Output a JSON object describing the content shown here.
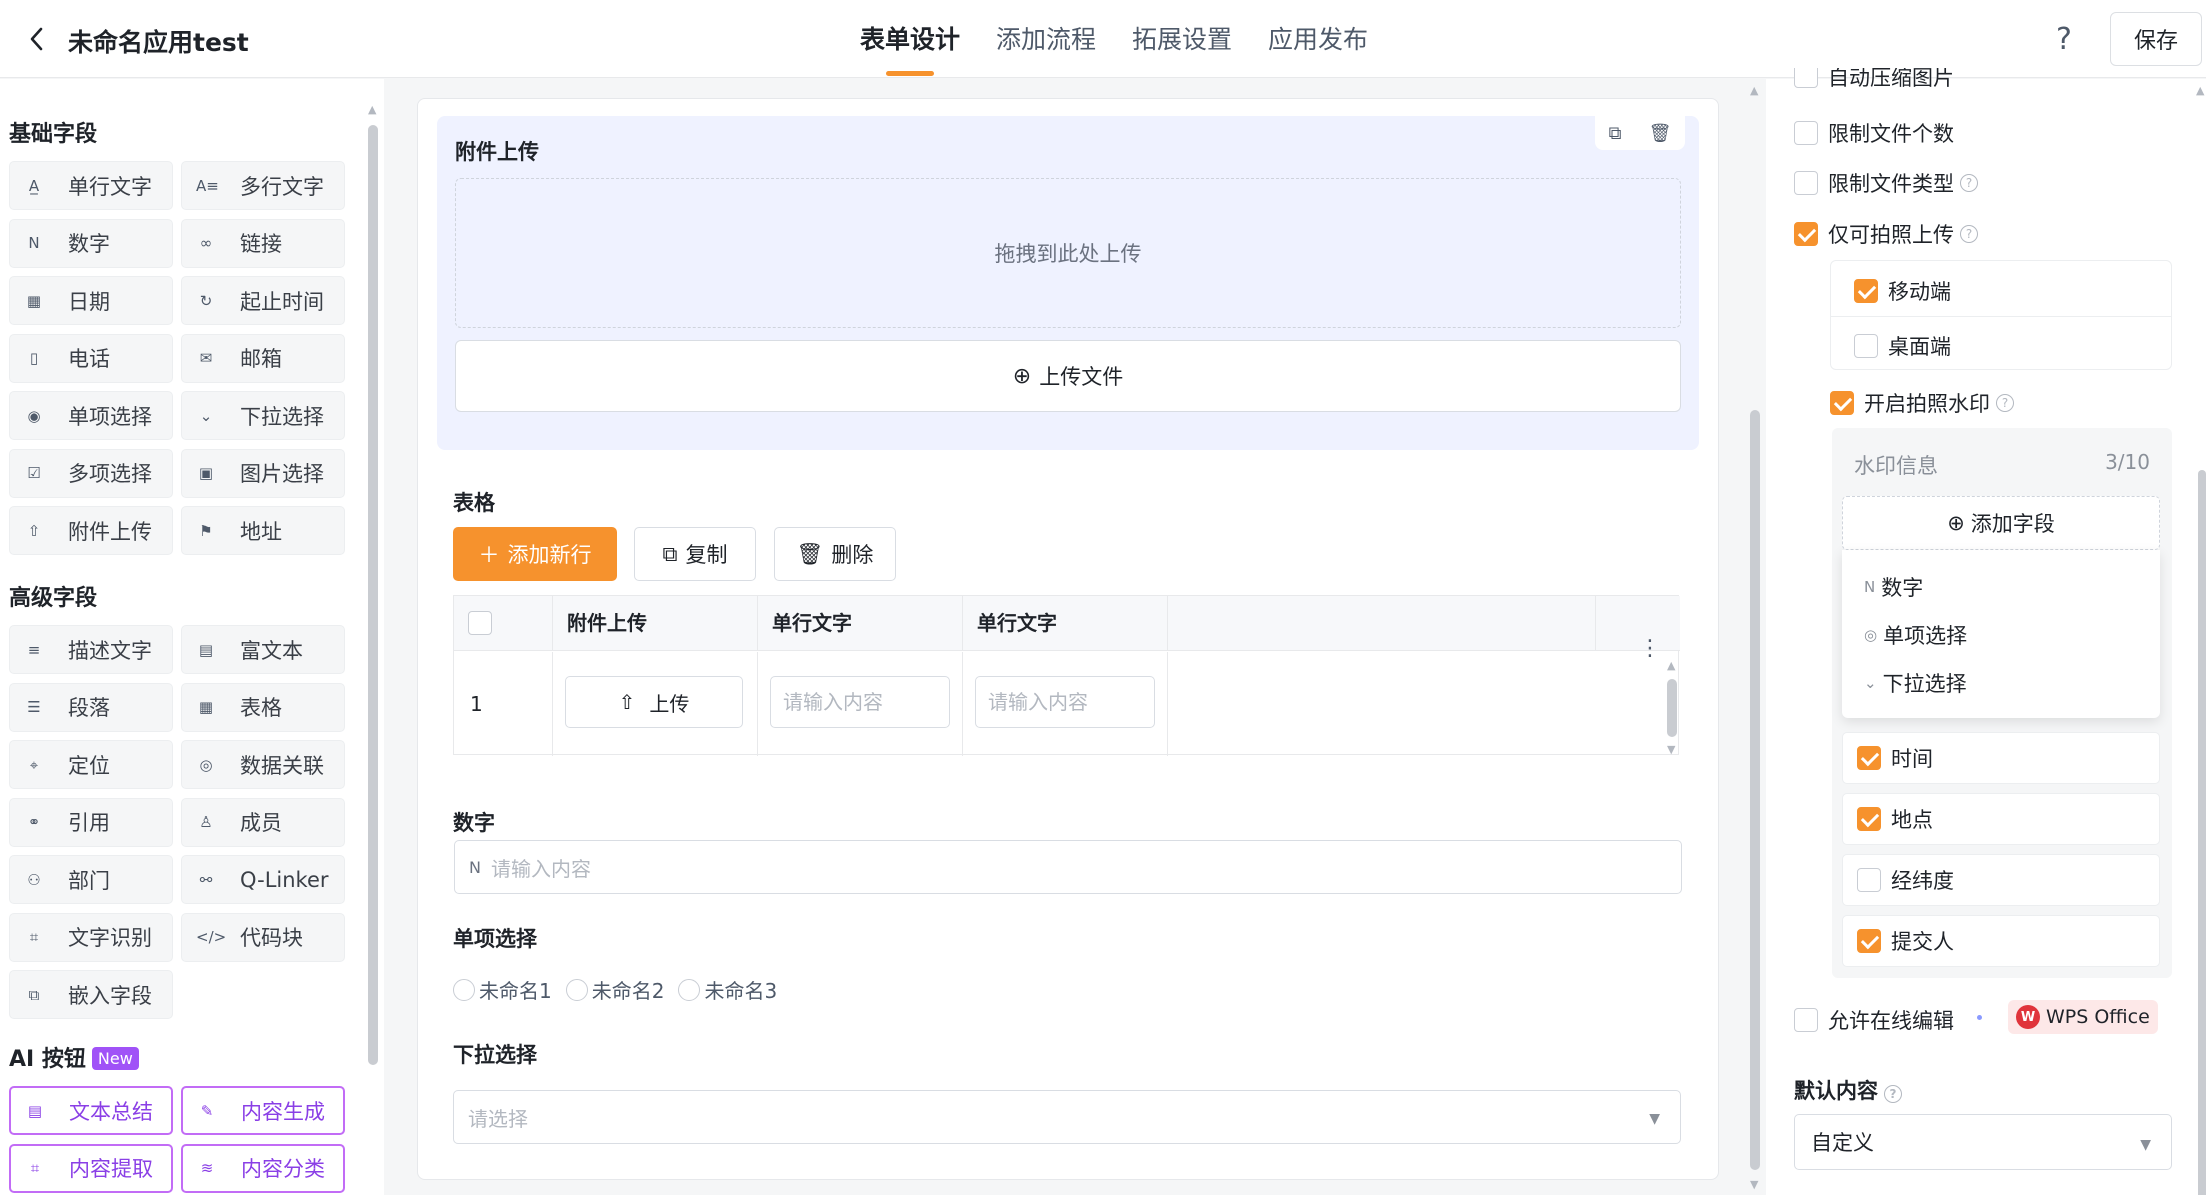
{
  "header": {
    "title": "未命名应用test",
    "tabs": [
      "表单设计",
      "添加流程",
      "拓展设置",
      "应用发布"
    ],
    "active_tab": "表单设计",
    "help": "?",
    "save_label": "保存"
  },
  "left": {
    "basic_title": "基础字段",
    "basic_fields": [
      {
        "label": "单行文字",
        "icon": "A̲"
      },
      {
        "label": "多行文字",
        "icon": "A≡"
      },
      {
        "label": "数字",
        "icon": "N"
      },
      {
        "label": "链接",
        "icon": "∞"
      },
      {
        "label": "日期",
        "icon": "▦"
      },
      {
        "label": "起止时间",
        "icon": "↻"
      },
      {
        "label": "电话",
        "icon": "▯"
      },
      {
        "label": "邮箱",
        "icon": "✉"
      },
      {
        "label": "单项选择",
        "icon": "◉"
      },
      {
        "label": "下拉选择",
        "icon": "⌄"
      },
      {
        "label": "多项选择",
        "icon": "☑"
      },
      {
        "label": "图片选择",
        "icon": "▣"
      },
      {
        "label": "附件上传",
        "icon": "⇧"
      },
      {
        "label": "地址",
        "icon": "⚑"
      }
    ],
    "advanced_title": "高级字段",
    "advanced_fields": [
      {
        "label": "描述文字",
        "icon": "≡"
      },
      {
        "label": "富文本",
        "icon": "▤"
      },
      {
        "label": "段落",
        "icon": "☰"
      },
      {
        "label": "表格",
        "icon": "▦"
      },
      {
        "label": "定位",
        "icon": "⌖"
      },
      {
        "label": "数据关联",
        "icon": "◎"
      },
      {
        "label": "引用",
        "icon": "⚭"
      },
      {
        "label": "成员",
        "icon": "♙"
      },
      {
        "label": "部门",
        "icon": "⚇"
      },
      {
        "label": "Q-Linker",
        "icon": "⚯"
      },
      {
        "label": "文字识别",
        "icon": "⌗"
      },
      {
        "label": "代码块",
        "icon": "</>"
      },
      {
        "label": "嵌入字段",
        "icon": "⧉"
      }
    ],
    "ai_title": "AI 按钮",
    "ai_badge": "New",
    "ai_fields": [
      {
        "label": "文本总结",
        "icon": "▤"
      },
      {
        "label": "内容生成",
        "icon": "✎"
      },
      {
        "label": "内容提取",
        "icon": "⌗"
      },
      {
        "label": "内容分类",
        "icon": "≋"
      }
    ]
  },
  "canvas": {
    "attachment": {
      "title": "附件上传",
      "drop_text": "拖拽到此处上传",
      "upload_btn": "上传文件",
      "tool_copy": "⧉",
      "tool_delete": "🗑"
    },
    "table": {
      "title": "表格",
      "add_row": "添加新行",
      "copy": "复制",
      "delete": "删除",
      "columns": [
        "附件上传",
        "单行文字",
        "单行文字"
      ],
      "row_number": "1",
      "upload_label": "上传",
      "placeholder": "请输入内容"
    },
    "number": {
      "title": "数字",
      "placeholder": "请输入内容"
    },
    "radio": {
      "title": "单项选择",
      "options": [
        "未命名1",
        "未命名2",
        "未命名3"
      ]
    },
    "select": {
      "title": "下拉选择",
      "placeholder": "请选择"
    }
  },
  "right": {
    "top_cut_label": "自动压缩图片",
    "limit_count": "限制文件个数",
    "limit_type": "限制文件类型",
    "photo_only": "仅可拍照上传",
    "mobile": "移动端",
    "desktop": "桌面端",
    "watermark": "开启拍照水印",
    "wm_info_title": "水印信息",
    "wm_count": "3/10",
    "wm_add": "添加字段",
    "dropdown_options": [
      {
        "label": "数字",
        "icon": "N"
      },
      {
        "label": "单项选择",
        "icon": "◎"
      },
      {
        "label": "下拉选择",
        "icon": "⌄"
      }
    ],
    "wm_items": [
      {
        "label": "时间",
        "checked": true
      },
      {
        "label": "地点",
        "checked": true
      },
      {
        "label": "经纬度",
        "checked": false
      },
      {
        "label": "提交人",
        "checked": true
      }
    ],
    "online_edit": "允许在线编辑",
    "wps_label": "WPS Office",
    "default_title": "默认内容",
    "default_value": "自定义"
  },
  "colors": {
    "accent": "#f6922d",
    "ai_purple": "#a052f7",
    "selected_bg": "#eff2ff"
  }
}
